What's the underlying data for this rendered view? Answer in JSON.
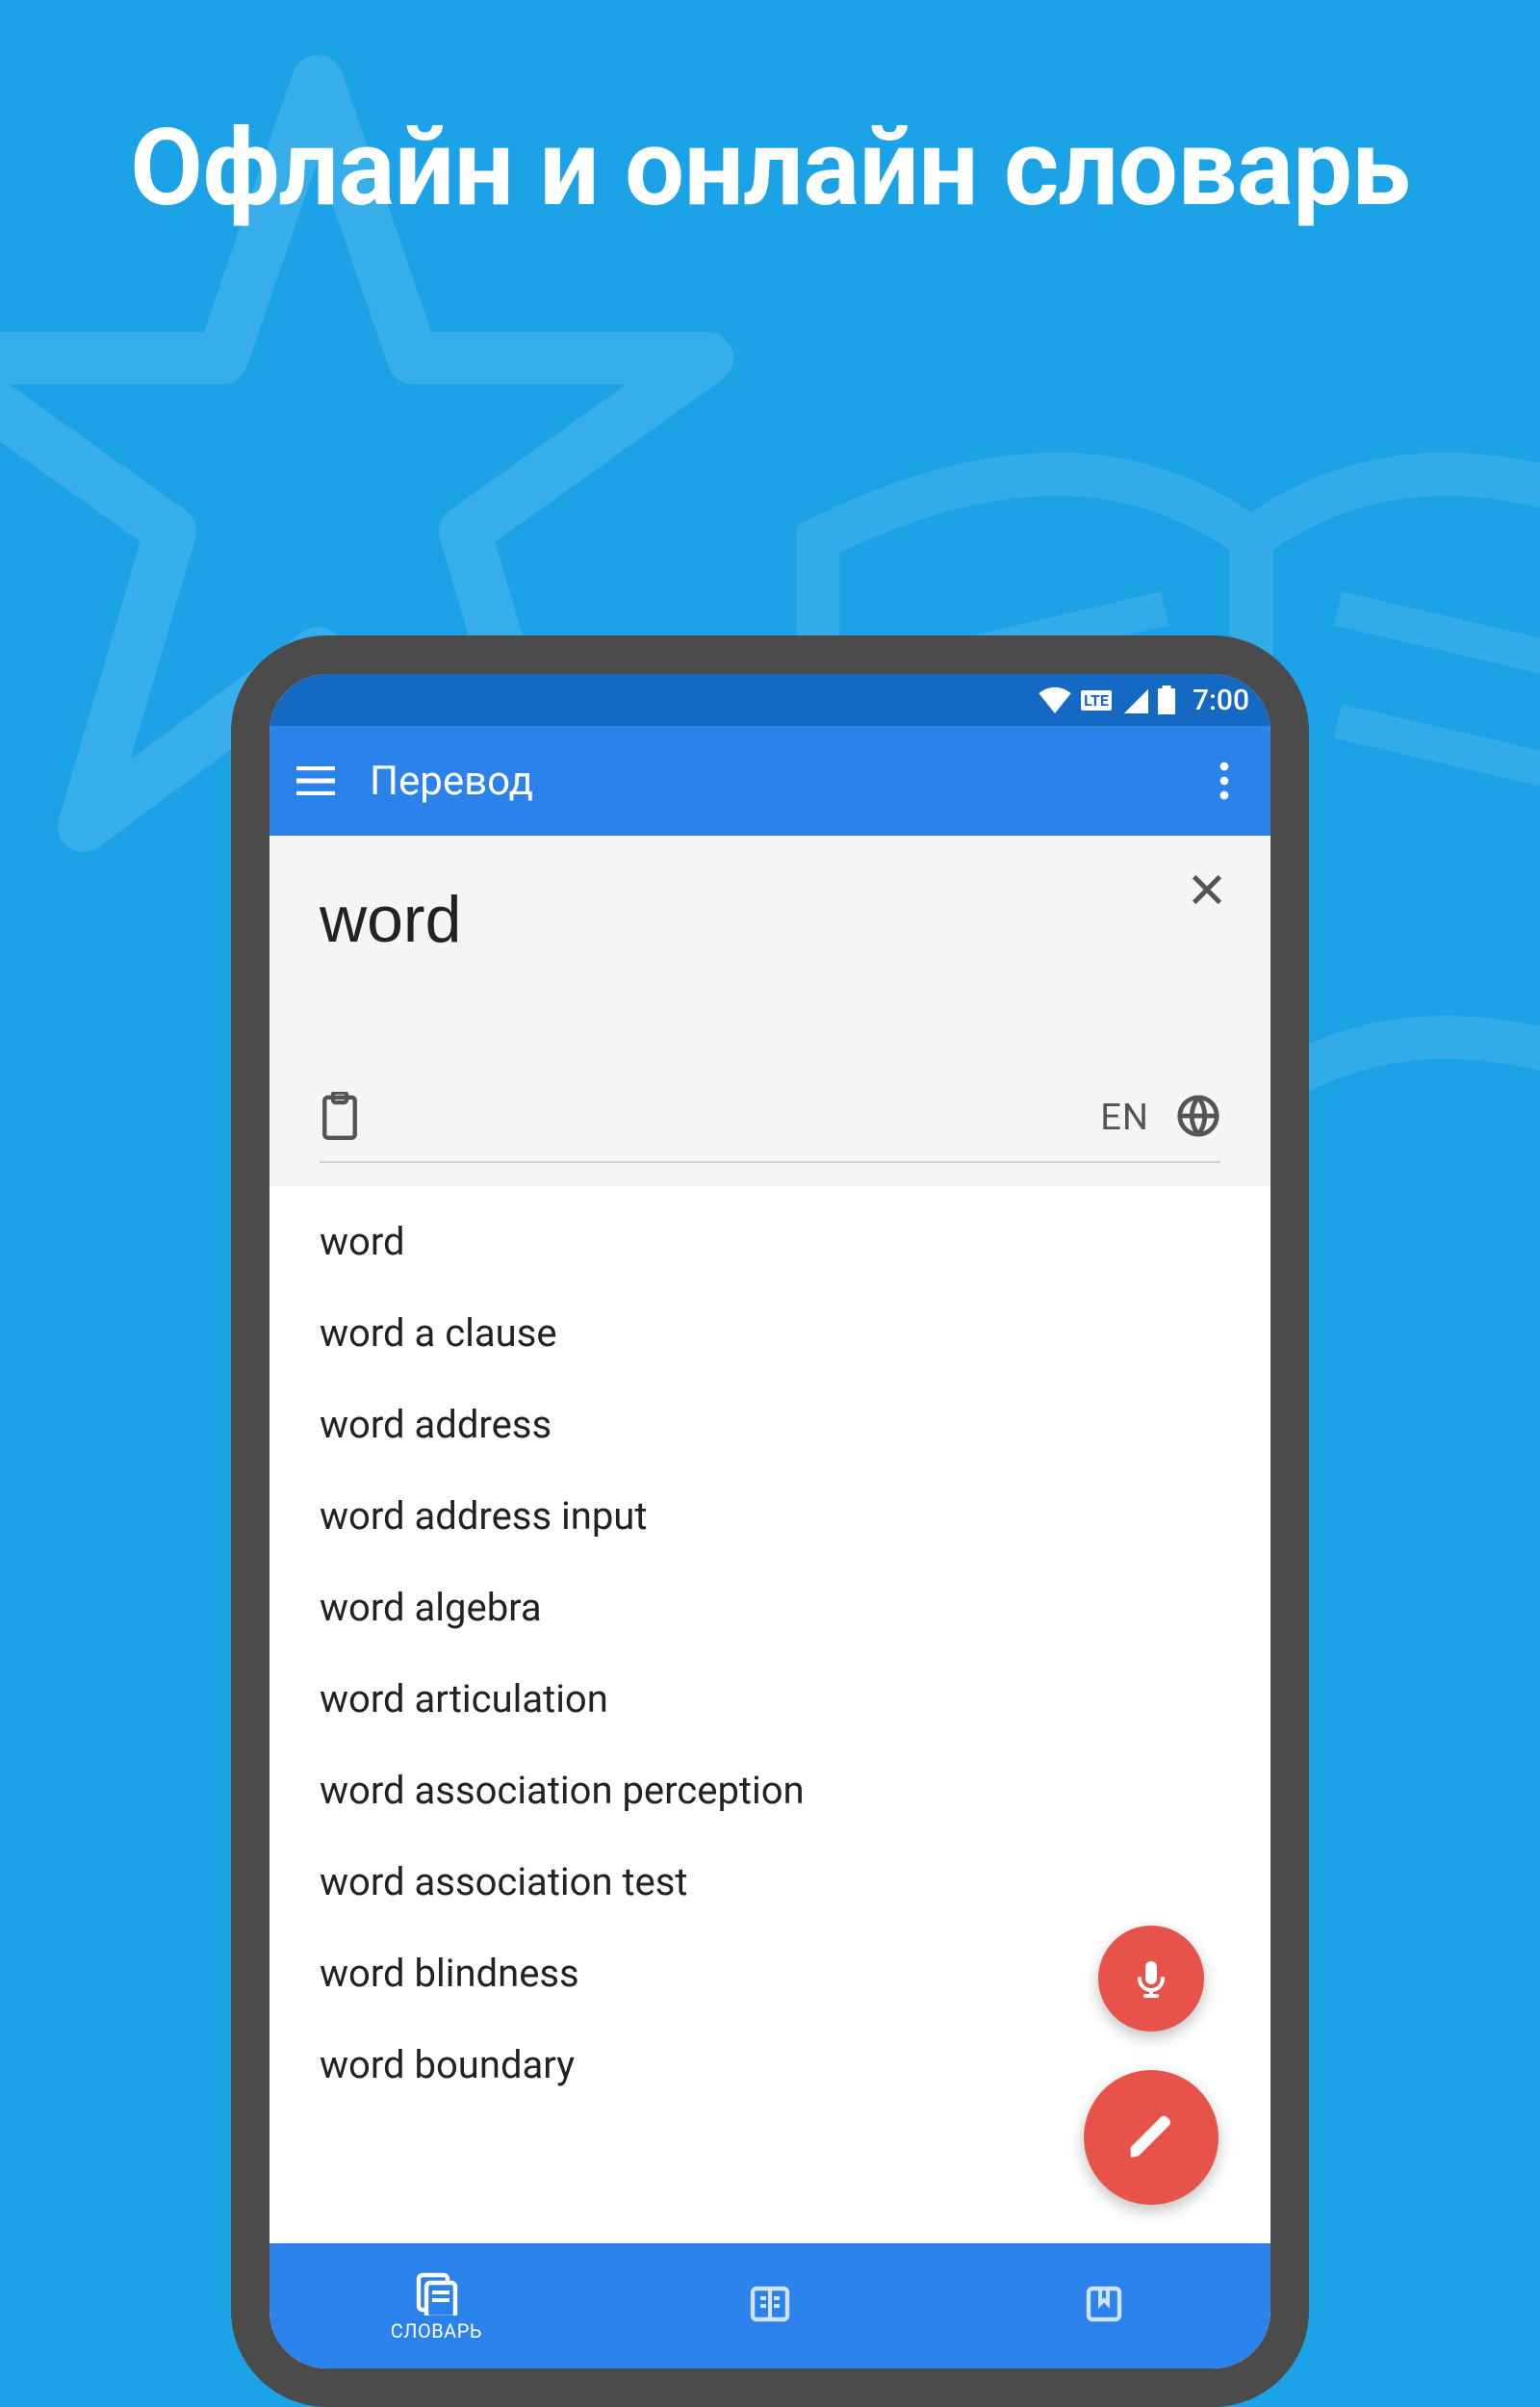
{
  "promo": {
    "headline": "Офлайн и онлайн словарь"
  },
  "status": {
    "network": "LTE",
    "time": "7:00"
  },
  "appbar": {
    "title": "Перевод"
  },
  "search": {
    "value": "word",
    "language": "EN"
  },
  "suggestions": [
    "word",
    "word a clause",
    "word address",
    "word address input",
    "word algebra",
    "word articulation",
    "word association perception",
    "word association test",
    "word blindness",
    "word boundary"
  ],
  "bottomnav": {
    "items": [
      {
        "label": "СЛОВАРЬ",
        "active": true
      },
      {
        "label": "",
        "active": false
      },
      {
        "label": "",
        "active": false
      }
    ]
  },
  "colors": {
    "background": "#1ba2e7",
    "appbar": "#2a82ea",
    "statusbar": "#1669c2",
    "fab": "#e7534b"
  }
}
